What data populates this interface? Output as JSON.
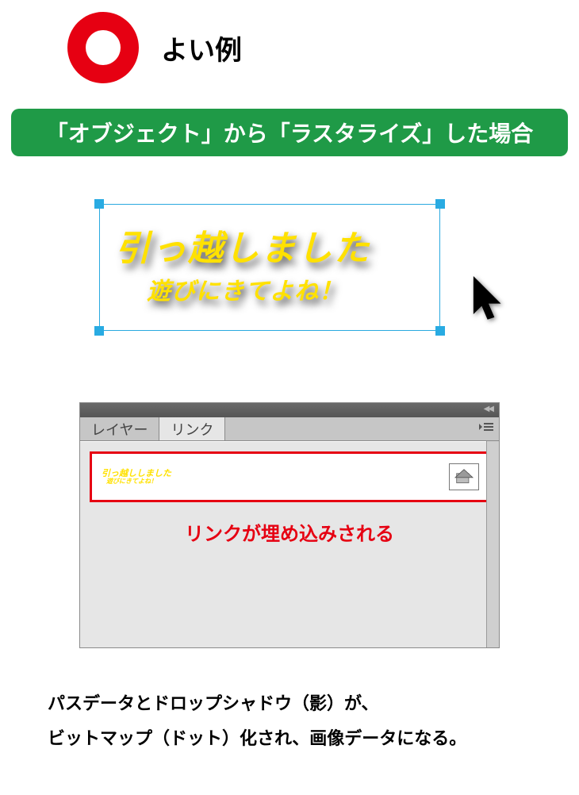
{
  "header": {
    "title": "よい例"
  },
  "banner": {
    "text": "「オブジェクト」から「ラスタライズ」した場合"
  },
  "raster": {
    "line1": "引っ越しました",
    "line2": "遊びにきてよね！"
  },
  "panel": {
    "tabs": {
      "layers": "レイヤー",
      "links": "リンク"
    },
    "thumb": {
      "line1": "引っ越ししました",
      "line2": "遊びにきてよね！"
    },
    "caption": "リンクが埋め込みされる"
  },
  "footer": {
    "line1": "パスデータとドロップシャドウ（影）が、",
    "line2": "ビットマップ（ドット）化され、画像データになる。"
  }
}
